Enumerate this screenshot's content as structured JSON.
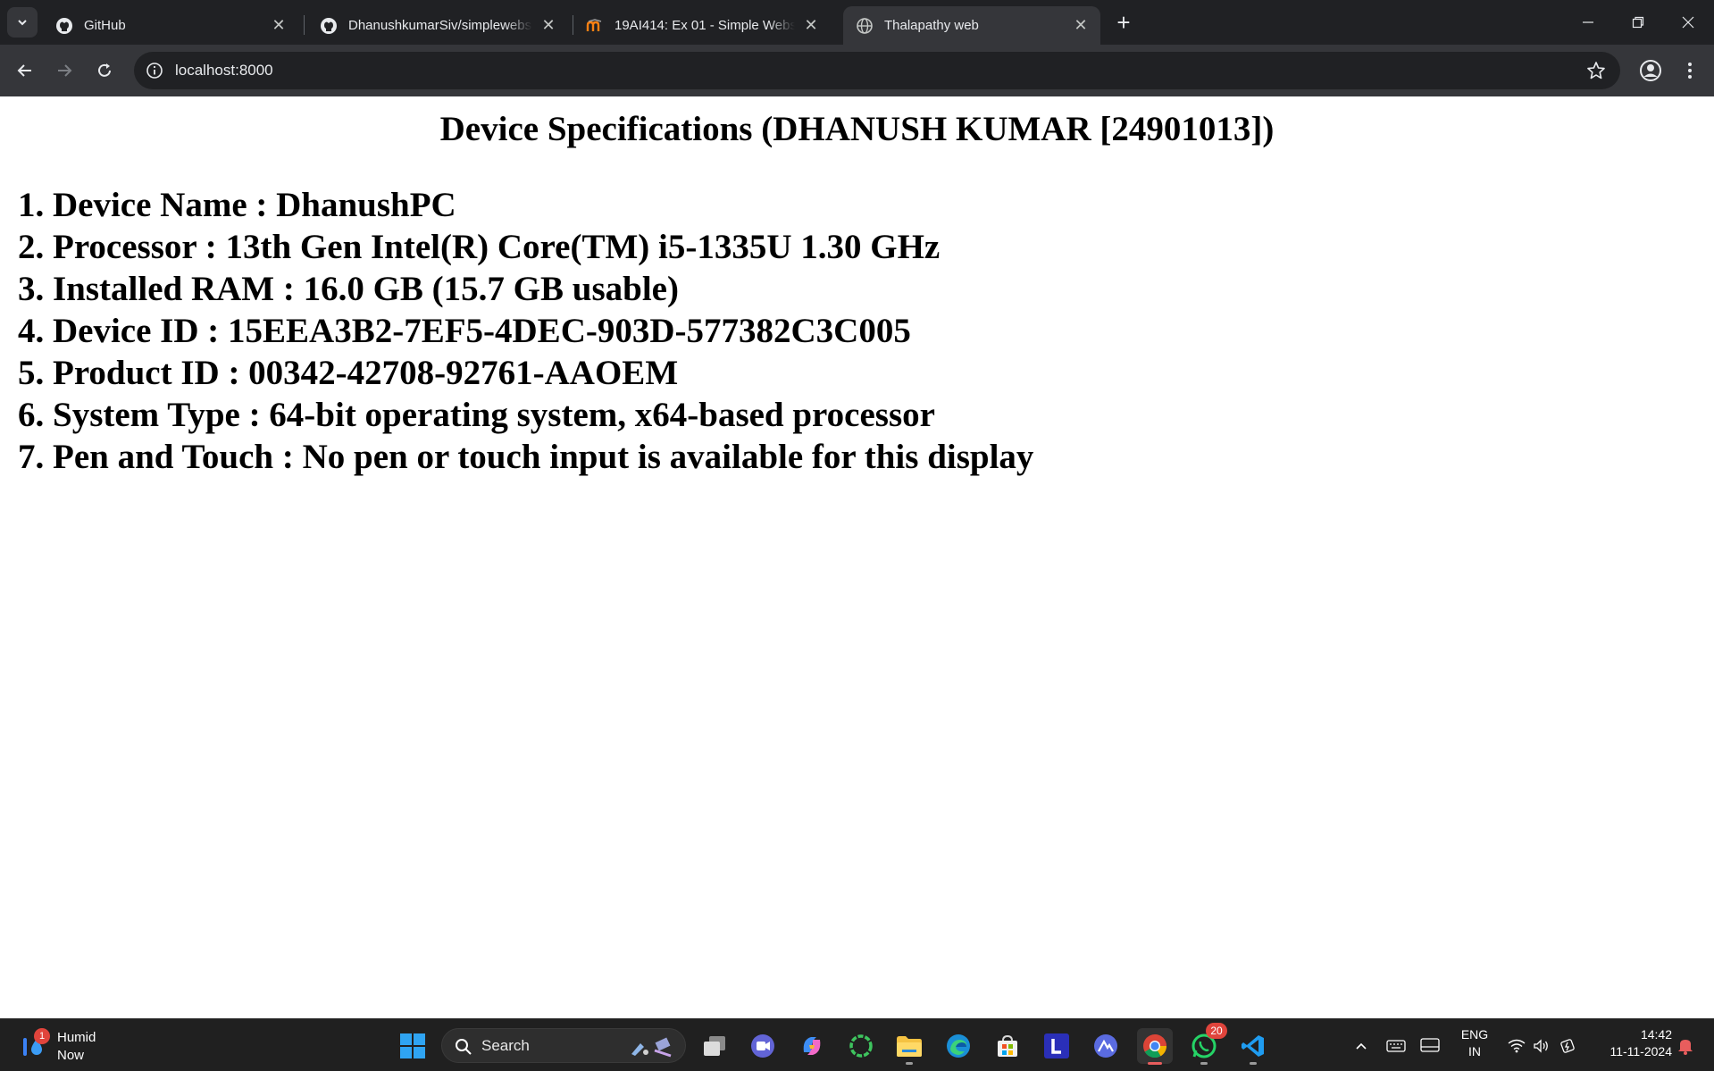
{
  "browser": {
    "tabs": [
      {
        "title": "GitHub",
        "favicon": "github-icon",
        "active": false
      },
      {
        "title": "DhanushkumarSiv/simplewebserver",
        "favicon": "github-icon",
        "active": false
      },
      {
        "title": "19AI414: Ex 01 - Simple Webserver",
        "favicon": "moodle-icon",
        "active": false
      },
      {
        "title": "Thalapathy web",
        "favicon": "globe-icon",
        "active": true
      }
    ],
    "url": "localhost:8000"
  },
  "page": {
    "heading": "Device Specifications (DHANUSH KUMAR [24901013])",
    "specs": [
      "1. Device Name : DhanushPC",
      "2. Processor : 13th Gen Intel(R) Core(TM) i5-1335U 1.30 GHz",
      "3. Installed RAM : 16.0 GB (15.7 GB usable)",
      "4. Device ID : 15EEA3B2-7EF5-4DEC-903D-577382C3C005",
      "5. Product ID : 00342-42708-92761-AAOEM",
      "6. System Type : 64-bit operating system, x64-based processor",
      "7. Pen and Touch : No pen or touch input is available for this display"
    ]
  },
  "taskbar": {
    "weather_badge": "1",
    "weather_title": "Humid",
    "weather_subtitle": "Now",
    "search_placeholder": "Search",
    "whatsapp_badge": "20",
    "language_line1": "ENG",
    "language_line2": "IN",
    "time": "14:42",
    "date": "11-11-2024"
  },
  "colors": {
    "tabstrip_bg": "#202124",
    "toolbar_bg": "#35363a",
    "taskbar_bg": "#202020",
    "badge_red": "#e0443c"
  }
}
